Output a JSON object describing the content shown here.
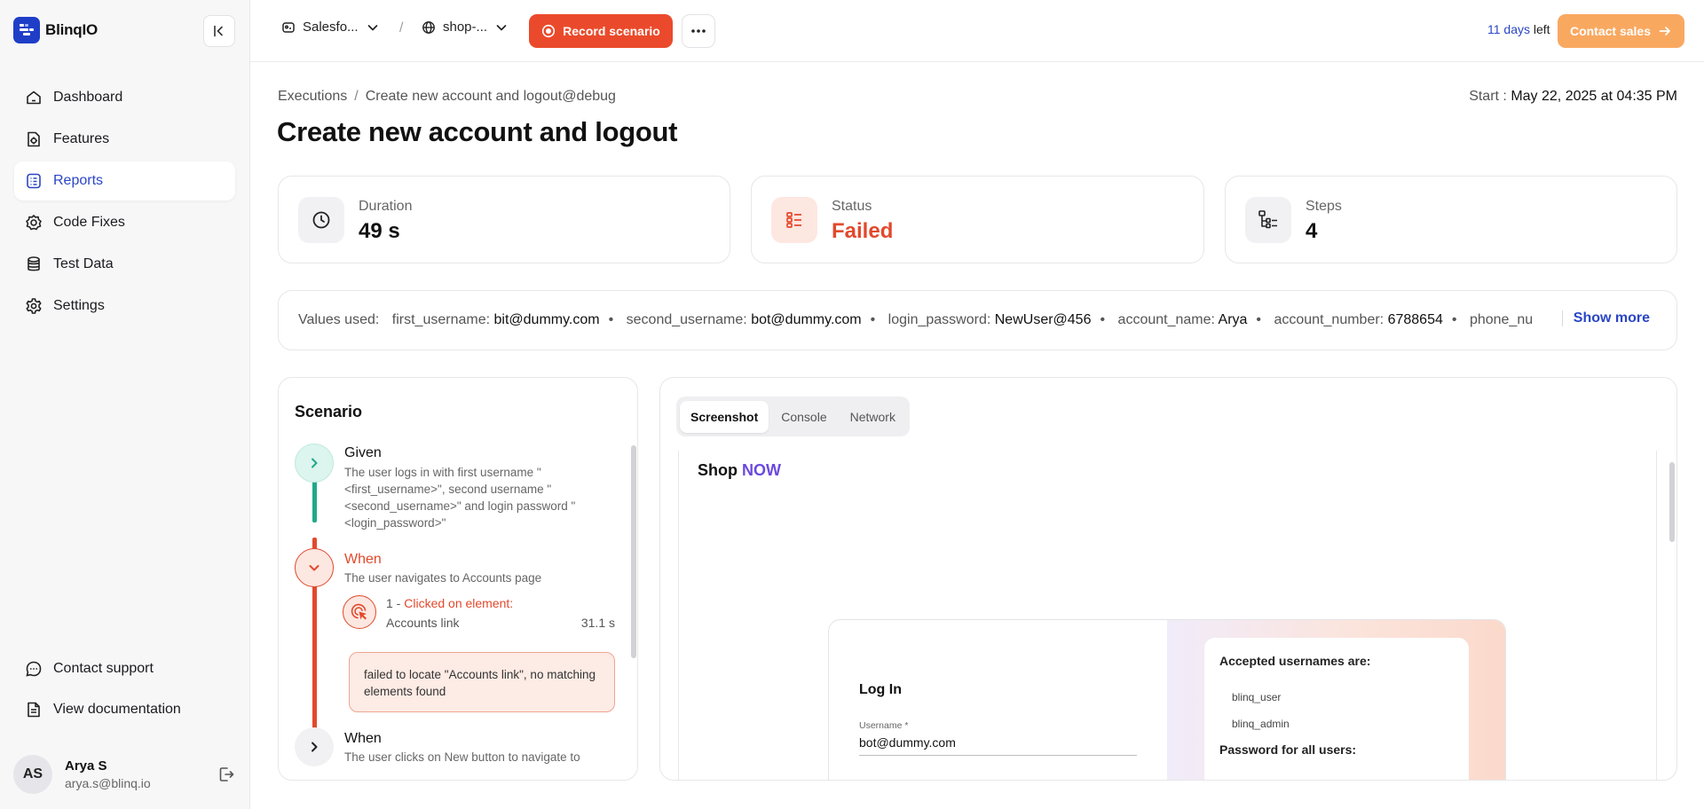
{
  "brand": {
    "name": "BlinqIO"
  },
  "sidebar": {
    "items": [
      {
        "label": "Dashboard",
        "icon": "home-icon"
      },
      {
        "label": "Features",
        "icon": "features-icon"
      },
      {
        "label": "Reports",
        "icon": "reports-icon",
        "active": true
      },
      {
        "label": "Code Fixes",
        "icon": "code-fixes-icon"
      },
      {
        "label": "Test Data",
        "icon": "database-icon"
      },
      {
        "label": "Settings",
        "icon": "gear-icon"
      }
    ],
    "bottom": [
      {
        "label": "Contact support",
        "icon": "chat-icon"
      },
      {
        "label": "View documentation",
        "icon": "document-icon"
      }
    ],
    "user": {
      "initials": "AS",
      "name": "Arya S",
      "email": "arya.s@blinq.io"
    }
  },
  "topbar": {
    "project": "Salesfo...",
    "environment": "shop-...",
    "record_label": "Record scenario",
    "trial_days": "11 days",
    "trial_suffix": " left",
    "contact_sales": "Contact sales"
  },
  "breadcrumb": {
    "root": "Executions",
    "current": "Create new account and logout@debug"
  },
  "start": {
    "label": "Start :",
    "value": "May 22, 2025 at 04:35 PM"
  },
  "page_title": "Create new account and logout",
  "stats": {
    "duration": {
      "label": "Duration",
      "value": "49 s"
    },
    "status": {
      "label": "Status",
      "value": "Failed"
    },
    "steps": {
      "label": "Steps",
      "value": "4"
    }
  },
  "values_used": {
    "label": "Values used:",
    "items": [
      {
        "key": "first_username:",
        "value": "bit@dummy.com"
      },
      {
        "key": "second_username:",
        "value": "bot@dummy.com"
      },
      {
        "key": "login_password:",
        "value": "NewUser@456"
      },
      {
        "key": "account_name:",
        "value": "Arya"
      },
      {
        "key": "account_number:",
        "value": "6788654"
      },
      {
        "key": "phone_nu",
        "value": ""
      }
    ],
    "show_more": "Show more"
  },
  "scenario": {
    "title": "Scenario",
    "steps": [
      {
        "keyword": "Given",
        "description": "The user logs in with first username \"<first_username>\", second username \"<second_username>\" and login password \"<login_password>\""
      },
      {
        "keyword": "When",
        "description": "The user navigates to Accounts page"
      },
      {
        "keyword": "When",
        "description": "The user clicks on New button to navigate to"
      }
    ],
    "substep": {
      "index": "1 -",
      "action": "Clicked on element:",
      "element": "Accounts link",
      "time": "31.1 s"
    },
    "error": "failed to locate \"Accounts link\", no matching elements found"
  },
  "tabs": [
    "Screenshot",
    "Console",
    "Network"
  ],
  "screenshot": {
    "shop_prefix": "Shop ",
    "shop_suffix": "NOW",
    "login_title": "Log In",
    "username_label": "Username *",
    "username_value": "bot@dummy.com",
    "accepted_title": "Accepted usernames are:",
    "accepted_users": [
      "blinq_user",
      "blinq_admin"
    ],
    "password_title": "Password for all users:"
  },
  "colors": {
    "accent": "#2a46c4",
    "record": "#ea4a2b",
    "failed": "#e2492c",
    "passed": "#21a98a",
    "contact": "#f9a860"
  }
}
